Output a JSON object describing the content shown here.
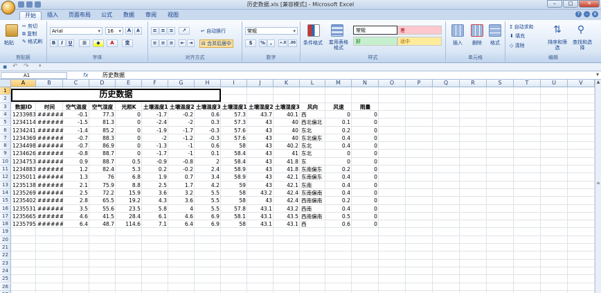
{
  "window": {
    "title": "历史数据.xls  [兼容模式] - Microsoft Excel"
  },
  "tabs": [
    "开始",
    "插入",
    "页面布局",
    "公式",
    "数据",
    "审阅",
    "视图"
  ],
  "ribbon": {
    "clipboard": {
      "label": "剪贴板",
      "paste": "粘贴",
      "cut": "剪切",
      "copy": "复制",
      "format_painter": "格式刷"
    },
    "font": {
      "label": "字体",
      "name": "Arial",
      "size": "16",
      "bold": "B",
      "italic": "I",
      "underline": "U",
      "grow": "A",
      "shrink": "A",
      "font_color": "A",
      "phonetic": "变"
    },
    "alignment": {
      "label": "对齐方式",
      "wrap": "自动换行",
      "merge": "合并后居中"
    },
    "number": {
      "label": "数字",
      "format": "常规",
      "percent": "%",
      "comma": ",",
      "inc": "+.0",
      "dec": ".00"
    },
    "styles": {
      "label": "样式",
      "conditional": "条件格式",
      "table": "套用表格格式",
      "normal": "常规",
      "bad": "差",
      "good": "好",
      "neutral": "适中"
    },
    "cells": {
      "label": "单元格",
      "insert": "插入",
      "delete": "删除",
      "format": "格式"
    },
    "editing": {
      "label": "编辑",
      "autosum": "Σ 自动求和",
      "fill": "填充",
      "clear": "清除",
      "sort": "排序和筛选",
      "find": "查找和选择"
    }
  },
  "namebox": "A1",
  "fx": "fx",
  "formula": "历史数据",
  "columns": [
    "A",
    "B",
    "C",
    "D",
    "E",
    "F",
    "G",
    "H",
    "I",
    "J",
    "K",
    "L",
    "M",
    "N",
    "O",
    "P",
    "Q",
    "R",
    "S",
    "T",
    "U",
    "V"
  ],
  "rows": [
    "1",
    "2",
    "3",
    "4",
    "5",
    "6",
    "7",
    "8",
    "9",
    "10",
    "11",
    "12",
    "13",
    "14",
    "15",
    "16",
    "17",
    "18",
    "19",
    "20",
    "21",
    "22",
    "23",
    "24",
    "25",
    "26",
    "27"
  ],
  "sheet": {
    "title": "历史数据",
    "headers": [
      "数据ID",
      "时间",
      "空气温度",
      "空气湿度",
      "光照K",
      "土壤温度1",
      "土壤温度2",
      "土壤温度3",
      "土壤湿度1",
      "土壤湿度2",
      "土壤湿度3",
      "风向",
      "风速",
      "雨量"
    ],
    "data": [
      [
        "12339834",
        "########",
        "-0.1",
        "77.3",
        "0",
        "-1.7",
        "-0.2",
        "0.6",
        "57.3",
        "43.7",
        "40.1",
        "西",
        "0",
        "0"
      ],
      [
        "12341142",
        "########",
        "-1.5",
        "81.3",
        "0",
        "-2.4",
        "-2",
        "0.3",
        "57.3",
        "43",
        "40",
        "西北偏北",
        "0.1",
        "0"
      ],
      [
        "12342411",
        "########",
        "-1.4",
        "85.2",
        "0",
        "-1.9",
        "-1.7",
        "-0.3",
        "57.6",
        "43",
        "40",
        "东北",
        "0.2",
        "0"
      ],
      [
        "12343695",
        "########",
        "-0.7",
        "88.3",
        "0",
        "-2",
        "-1.2",
        "-0.3",
        "57.6",
        "43",
        "40",
        "东北偏东",
        "0.4",
        "0"
      ],
      [
        "12344986",
        "########",
        "-0.7",
        "86.9",
        "0",
        "-1.3",
        "-1",
        "0.6",
        "58",
        "43",
        "40.2",
        "东北",
        "0.4",
        "0"
      ],
      [
        "12346269",
        "########",
        "-0.8",
        "88.7",
        "0",
        "-1.7",
        "-1",
        "0.1",
        "58.4",
        "43",
        "41",
        "东北",
        "0",
        "0"
      ],
      [
        "12347536",
        "########",
        "0.9",
        "88.7",
        "0.5",
        "-0.9",
        "-0.8",
        "2",
        "58.4",
        "43",
        "41.8",
        "东",
        "0",
        "0"
      ],
      [
        "12348837",
        "########",
        "1.2",
        "82.4",
        "5.3",
        "0.2",
        "-0.2",
        "2.4",
        "58.9",
        "43",
        "41.8",
        "东南偏东",
        "0.2",
        "0"
      ],
      [
        "12350110",
        "########",
        "1.3",
        "76",
        "6.8",
        "1.9",
        "0.7",
        "3.4",
        "58.9",
        "43",
        "42.1",
        "东南偏东",
        "0.4",
        "0"
      ],
      [
        "12351384",
        "########",
        "2.1",
        "75.9",
        "8.8",
        "2.5",
        "1.7",
        "4.2",
        "59",
        "43",
        "42.1",
        "东南",
        "0.4",
        "0"
      ],
      [
        "12352690",
        "########",
        "2.5",
        "72.2",
        "15.9",
        "3.6",
        "3.2",
        "5.5",
        "58",
        "43.2",
        "42.4",
        "东南偏南",
        "0.4",
        "0"
      ],
      [
        "12354020",
        "########",
        "2.8",
        "65.5",
        "19.2",
        "4.3",
        "3.6",
        "5.5",
        "58",
        "43",
        "42.4",
        "西南偏南",
        "0.2",
        "0"
      ],
      [
        "12355317",
        "########",
        "3.5",
        "55.6",
        "23.5",
        "5.8",
        "4",
        "5.5",
        "57.8",
        "43.1",
        "43.2",
        "西南",
        "0.4",
        "0"
      ],
      [
        "12356659",
        "########",
        "4.6",
        "41.5",
        "28.4",
        "6.1",
        "4.6",
        "6.9",
        "58.1",
        "43.1",
        "43.5",
        "西南偏南",
        "0.5",
        "0"
      ],
      [
        "12357958",
        "########",
        "6.4",
        "48.7",
        "114.6",
        "7.1",
        "6.4",
        "6.9",
        "58",
        "43.1",
        "43.1",
        "西",
        "0.6",
        "0"
      ]
    ]
  },
  "colors": {
    "accent": "#f6c66a",
    "bad_fill": "#ffc7ce",
    "good_fill": "#c6efce",
    "neutral_fill": "#ffeb9c"
  }
}
